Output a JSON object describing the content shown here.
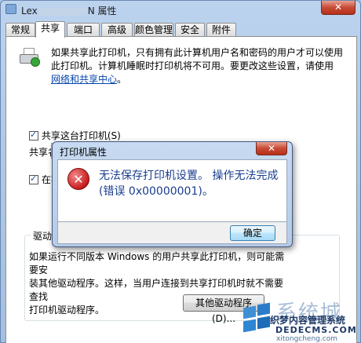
{
  "window": {
    "title_prefix": "Lex",
    "title_suffix": "N 属性",
    "close_label": "✕"
  },
  "tabs": [
    "常规",
    "共享",
    "端口",
    "高级",
    "颜色管理",
    "安全",
    "附件"
  ],
  "sharing": {
    "intro": "如果共享此打印机，只有拥有此计算机用户名和密码的用户才可以使用此打印机。计算机睡眠时打印机将不可用。要更改这些设置，请使用",
    "intro_link": "网络和共享中心",
    "intro_end": "。",
    "share_checkbox_label": "共享这台打印机(S)",
    "share_name_label": "共享名(",
    "render_checkbox_label": "在客",
    "drivers_group_label": "驱动程",
    "drivers_text_1": "如果运行不同版本 Windows 的用户共享此打印机，则可能需要安",
    "drivers_text_2": "装其他驱动程序。这样，当用户连接到共享打印机时就不需要查找",
    "drivers_text_3": "打印机驱动程序。",
    "additional_drivers_button": "其他驱动程序(D)..."
  },
  "dialog": {
    "title": "打印机属性",
    "close_label": "✕",
    "error_symbol": "✕",
    "message": "无法保存打印机设置。 操作无法完成(错误 0x00000001)。",
    "ok_button": "确定"
  },
  "watermark": {
    "big_text": "系统城",
    "line1": "织梦内容管理系统",
    "line2": "DEDECMS.COM",
    "line3": "xitongcheng.com"
  },
  "colors": {
    "accent_blue": "#1a3d8f",
    "error_red": "#c81c1c",
    "link": "#0645ad"
  }
}
